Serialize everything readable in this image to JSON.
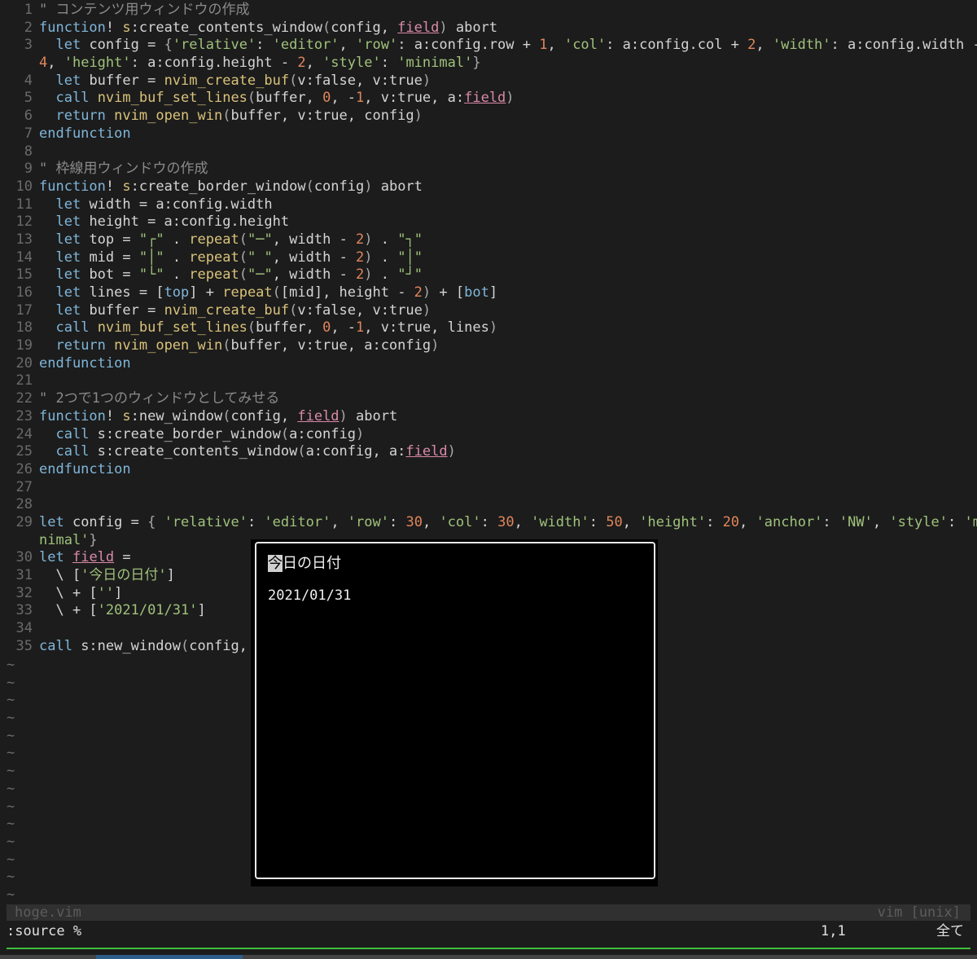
{
  "editor": {
    "lines": {
      "l1": "1",
      "l2": "2",
      "l3": "3",
      "l4": "4",
      "l5": "5",
      "l6": "6",
      "l7": "7",
      "l8": "8",
      "l9": "9",
      "l10": "10",
      "l11": "11",
      "l12": "12",
      "l13": "13",
      "l14": "14",
      "l15": "15",
      "l16": "16",
      "l17": "17",
      "l18": "18",
      "l19": "19",
      "l20": "20",
      "l21": "21",
      "l22": "22",
      "l23": "23",
      "l24": "24",
      "l25": "25",
      "l26": "26",
      "l27": "27",
      "l28": "28",
      "l29": "29",
      "l30": "30",
      "l31": "31",
      "l32": "32",
      "l33": "33",
      "l34": "34",
      "l35": "35"
    },
    "comments": {
      "c1": "\" コンテンツ用ウィンドウの作成",
      "c9": "\" 枠線用ウィンドウの作成",
      "c22": "\" 2つで1つのウィンドウとしてみせる"
    },
    "empty_line_marker": "~"
  },
  "popup": {
    "title_cursor_char": "今",
    "title_rest": "日の日付",
    "date": "2021/01/31"
  },
  "statusline": {
    "filename": "hoge.vim",
    "filetype": "vim",
    "fileformat": "[unix]"
  },
  "cmdline": {
    "command": ":source %",
    "position": "1,1",
    "percent": "全て"
  }
}
